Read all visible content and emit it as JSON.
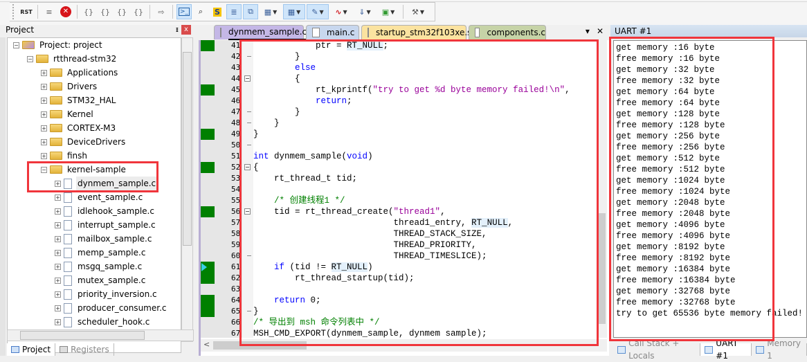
{
  "toolbar": {
    "buttons": [
      {
        "name": "reset-button",
        "glyph": "RST"
      },
      {
        "name": "run-to-cursor-button",
        "glyph": "≡"
      },
      {
        "name": "stop-button",
        "glyph": "✕"
      },
      {
        "name": "step-into-button",
        "glyph": "{}"
      },
      {
        "name": "step-over-button",
        "glyph": "{}"
      },
      {
        "name": "step-out-button",
        "glyph": "{}"
      },
      {
        "name": "run-to-line-button",
        "glyph": "{}"
      },
      {
        "name": "show-next-statement-button",
        "glyph": "⇨"
      },
      {
        "name": "command-window-button",
        "glyph": ">_"
      },
      {
        "name": "disassembly-window-button",
        "glyph": "⌕"
      },
      {
        "name": "symbols-window-button",
        "glyph": "S"
      },
      {
        "name": "registers-window-button",
        "glyph": "≣"
      },
      {
        "name": "call-stack-window-button",
        "glyph": "⧉"
      },
      {
        "name": "watch-windows-button",
        "glyph": "▦"
      },
      {
        "name": "memory-windows-button",
        "glyph": "▦"
      },
      {
        "name": "serial-windows-button",
        "glyph": "✎"
      },
      {
        "name": "analysis-windows-button",
        "glyph": "∿"
      },
      {
        "name": "trace-windows-button",
        "glyph": "⇓"
      },
      {
        "name": "system-viewer-button",
        "glyph": "▣"
      },
      {
        "name": "toolbox-button",
        "glyph": "⚒"
      }
    ]
  },
  "project_panel": {
    "title": "Project",
    "pin_glyph": "ᵻ",
    "close_glyph": "x",
    "tree": [
      {
        "label": "Project: project",
        "level": 0,
        "type": "root",
        "expanded": true
      },
      {
        "label": "rtthread-stm32",
        "level": 1,
        "type": "target",
        "expanded": true
      },
      {
        "label": "Applications",
        "level": 2,
        "type": "folder"
      },
      {
        "label": "Drivers",
        "level": 2,
        "type": "folder"
      },
      {
        "label": "STM32_HAL",
        "level": 2,
        "type": "folder"
      },
      {
        "label": "Kernel",
        "level": 2,
        "type": "folder"
      },
      {
        "label": "CORTEX-M3",
        "level": 2,
        "type": "folder"
      },
      {
        "label": "DeviceDrivers",
        "level": 2,
        "type": "folder"
      },
      {
        "label": "finsh",
        "level": 2,
        "type": "folder"
      },
      {
        "label": "kernel-sample",
        "level": 2,
        "type": "folder",
        "expanded": true
      },
      {
        "label": "dynmem_sample.c",
        "level": 3,
        "type": "file",
        "selected": true
      },
      {
        "label": "event_sample.c",
        "level": 3,
        "type": "file"
      },
      {
        "label": "idlehook_sample.c",
        "level": 3,
        "type": "file"
      },
      {
        "label": "interrupt_sample.c",
        "level": 3,
        "type": "file"
      },
      {
        "label": "mailbox_sample.c",
        "level": 3,
        "type": "file"
      },
      {
        "label": "memp_sample.c",
        "level": 3,
        "type": "file"
      },
      {
        "label": "msgq_sample.c",
        "level": 3,
        "type": "file"
      },
      {
        "label": "mutex_sample.c",
        "level": 3,
        "type": "file"
      },
      {
        "label": "priority_inversion.c",
        "level": 3,
        "type": "file"
      },
      {
        "label": "producer_consumer.c",
        "level": 3,
        "type": "file"
      },
      {
        "label": "scheduler_hook.c",
        "level": 3,
        "type": "file"
      }
    ],
    "tabs": [
      {
        "label": "Project",
        "active": true
      },
      {
        "label": "Registers",
        "active": false
      }
    ]
  },
  "editor": {
    "tabs": [
      {
        "label": "dynmem_sample.c",
        "active": true,
        "color": "#c4b7e6"
      },
      {
        "label": "main.c",
        "active": false,
        "color": "#c8d7ee"
      },
      {
        "label": "startup_stm32f103xe.s",
        "active": false,
        "color": "#fbe3a0"
      },
      {
        "label": "components.c",
        "active": false,
        "color": "#c6d3a7"
      }
    ],
    "tab_menu_glyph": "▾",
    "tab_close_glyph": "✕",
    "lines": [
      {
        "n": "41",
        "bp": true,
        "fold": "",
        "html": "            ptr = <span class='hl'>RT_NULL</span>;"
      },
      {
        "n": "42",
        "bp": false,
        "fold": "end",
        "html": "        }"
      },
      {
        "n": "43",
        "bp": false,
        "fold": "",
        "html": "        <span class='kw'>else</span>"
      },
      {
        "n": "44",
        "bp": false,
        "fold": "box",
        "html": "        {"
      },
      {
        "n": "45",
        "bp": true,
        "fold": "",
        "html": "            rt_kprintf(<span class='str'>\"try to get %d byte memory failed!\\n\"</span>,"
      },
      {
        "n": "46",
        "bp": false,
        "fold": "",
        "html": "            <span class='kw'>return</span>;"
      },
      {
        "n": "47",
        "bp": false,
        "fold": "end",
        "html": "        }"
      },
      {
        "n": "48",
        "bp": false,
        "fold": "end",
        "html": "    }"
      },
      {
        "n": "49",
        "bp": true,
        "fold": "",
        "html": "}"
      },
      {
        "n": "50",
        "bp": false,
        "fold": "end",
        "html": ""
      },
      {
        "n": "51",
        "bp": false,
        "fold": "",
        "html": "<span class='kw'>int</span> dynmem_sample(<span class='kw'>void</span>)"
      },
      {
        "n": "52",
        "bp": true,
        "fold": "box",
        "html": "{"
      },
      {
        "n": "53",
        "bp": false,
        "fold": "",
        "html": "    rt_thread_t tid;"
      },
      {
        "n": "54",
        "bp": false,
        "fold": "",
        "html": ""
      },
      {
        "n": "55",
        "bp": false,
        "fold": "",
        "html": "    <span class='cmt'>/* 创建线程1 */</span>"
      },
      {
        "n": "56",
        "bp": true,
        "fold": "box",
        "html": "    tid = rt_thread_create(<span class='str'>\"thread1\"</span>,"
      },
      {
        "n": "57",
        "bp": false,
        "fold": "",
        "html": "                           thread1_entry, <span class='hl'>RT_NULL</span>,"
      },
      {
        "n": "58",
        "bp": false,
        "fold": "",
        "html": "                           THREAD_STACK_SIZE,"
      },
      {
        "n": "59",
        "bp": false,
        "fold": "",
        "html": "                           THREAD_PRIORITY,"
      },
      {
        "n": "60",
        "bp": false,
        "fold": "end",
        "html": "                           THREAD_TIMESLICE);"
      },
      {
        "n": "61",
        "bp": true,
        "fold": "",
        "cursor": true,
        "html": "    <span class='kw'>if</span> (tid != <span class='hl'>RT_NULL</span>)"
      },
      {
        "n": "62",
        "bp": true,
        "fold": "",
        "html": "        rt_thread_startup(tid);"
      },
      {
        "n": "63",
        "bp": false,
        "fold": "",
        "html": ""
      },
      {
        "n": "64",
        "bp": true,
        "fold": "",
        "html": "    <span class='kw'>return</span> 0;"
      },
      {
        "n": "65",
        "bp": true,
        "fold": "end",
        "html": "}"
      },
      {
        "n": "66",
        "bp": false,
        "fold": "",
        "html": "<span class='cmt'>/* 导出到 msh 命令列表中 */</span>"
      },
      {
        "n": "67",
        "bp": false,
        "fold": "",
        "html": "MSH_CMD_EXPORT(dynmem_sample, dynmem sample);"
      }
    ]
  },
  "uart_panel": {
    "title": "UART #1",
    "lines": [
      "get memory :16 byte",
      "free memory :16 byte",
      "get memory :32 byte",
      "free memory :32 byte",
      "get memory :64 byte",
      "free memory :64 byte",
      "get memory :128 byte",
      "free memory :128 byte",
      "get memory :256 byte",
      "free memory :256 byte",
      "get memory :512 byte",
      "free memory :512 byte",
      "get memory :1024 byte",
      "free memory :1024 byte",
      "get memory :2048 byte",
      "free memory :2048 byte",
      "get memory :4096 byte",
      "free memory :4096 byte",
      "get memory :8192 byte",
      "free memory :8192 byte",
      "get memory :16384 byte",
      "free memory :16384 byte",
      "get memory :32768 byte",
      "free memory :32768 byte",
      "try to get 65536 byte memory failed!"
    ],
    "tabs": [
      {
        "label": "Call Stack + Locals",
        "active": false
      },
      {
        "label": "UART #1",
        "active": true
      },
      {
        "label": "Memory 1",
        "active": false
      }
    ]
  },
  "annotation_color": "#f0353b"
}
